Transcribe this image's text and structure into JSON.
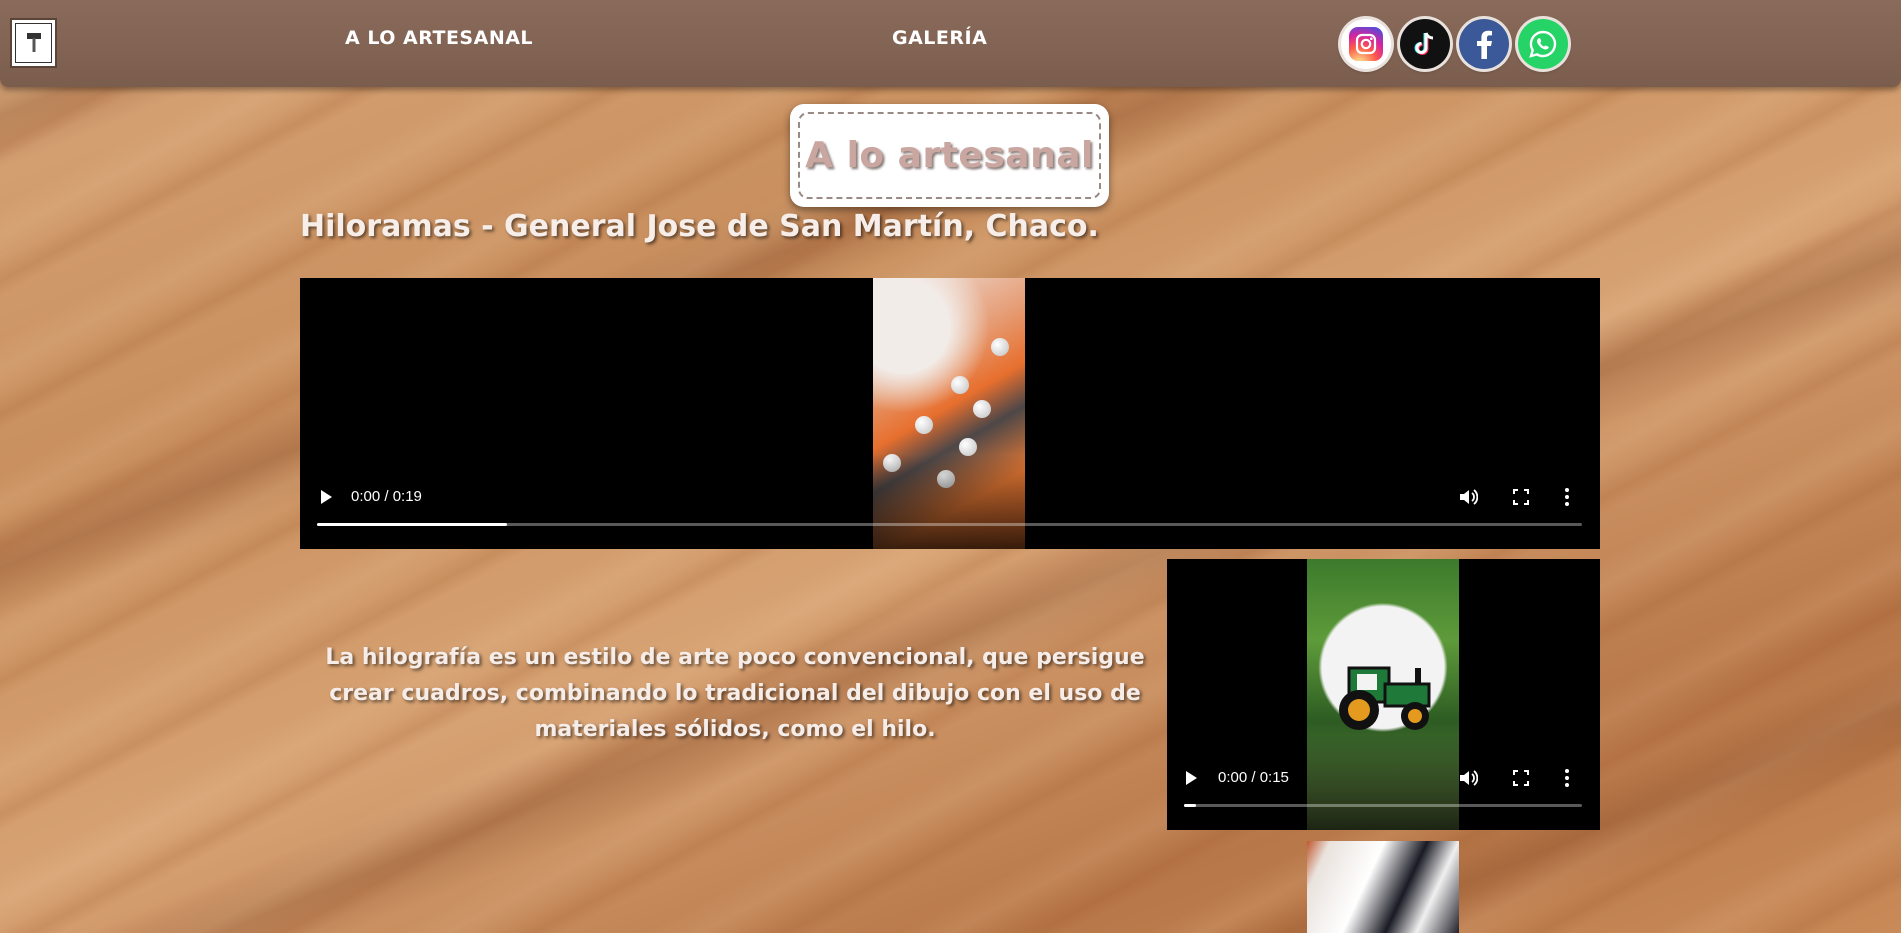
{
  "header": {
    "logo_alt": "A LO ARTESANAL logo",
    "nav": [
      {
        "label": "A LO ARTESANAL"
      },
      {
        "label": "GALERÍA"
      }
    ],
    "social": [
      {
        "name": "instagram-icon"
      },
      {
        "name": "tiktok-icon"
      },
      {
        "name": "facebook-icon"
      },
      {
        "name": "whatsapp-icon"
      }
    ]
  },
  "title_card": {
    "text": "A lo artesanal"
  },
  "section": {
    "heading": "Hiloramas - General Jose de San Martín, Chaco.",
    "description": "La hilografía es un estilo de arte poco convencional, que persigue crear cuadros, combinando lo tradicional del dibujo con el uso de materiales sólidos, como el hilo."
  },
  "videos": [
    {
      "time": "0:00 / 0:19",
      "progress": 0.15
    },
    {
      "time": "0:00 / 0:15",
      "progress": 0.03
    }
  ],
  "colors": {
    "header": "#7b5d4e",
    "title_text": "#c9a6a0",
    "instagram": "#d6249f",
    "facebook": "#3b5998",
    "whatsapp": "#25d366",
    "tiktok": "#111111"
  }
}
